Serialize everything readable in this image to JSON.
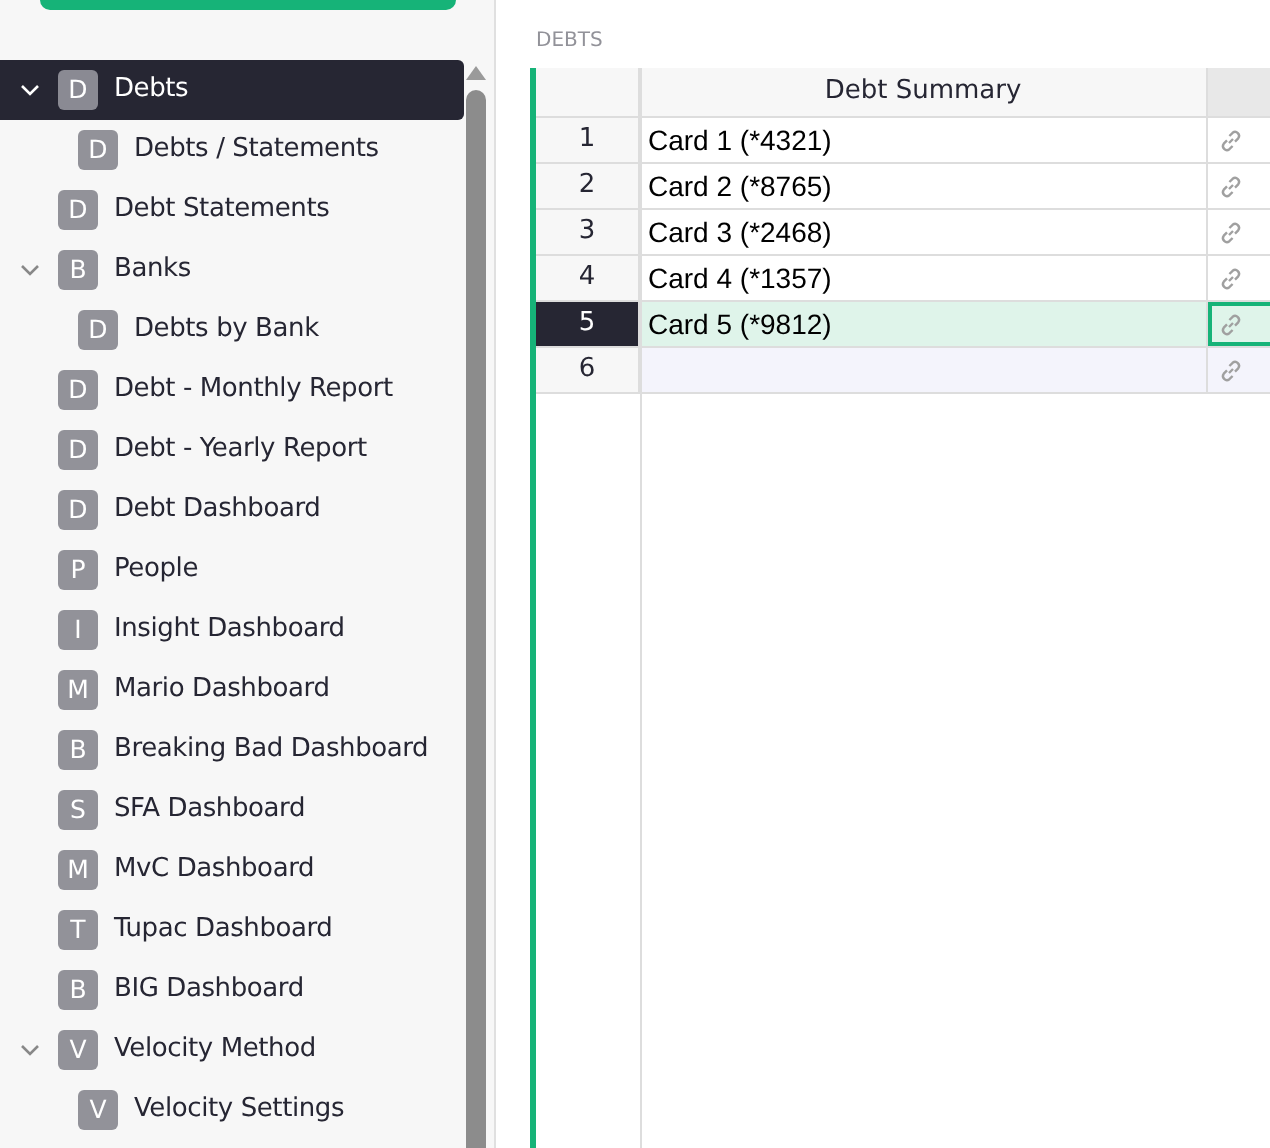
{
  "sidebar": {
    "items": [
      {
        "label": "Debts",
        "badge": "D",
        "selected": true,
        "expanded": true,
        "children": [
          {
            "label": "Debts / Statements",
            "badge": "D",
            "selected": false
          }
        ]
      },
      {
        "label": "Debt Statements",
        "badge": "D",
        "selected": false
      },
      {
        "label": "Banks",
        "badge": "B",
        "selected": false,
        "expanded": true,
        "children": [
          {
            "label": "Debts by Bank",
            "badge": "D",
            "selected": false
          }
        ]
      },
      {
        "label": "Debt - Monthly Report",
        "badge": "D",
        "selected": false
      },
      {
        "label": "Debt - Yearly Report",
        "badge": "D",
        "selected": false
      },
      {
        "label": "Debt Dashboard",
        "badge": "D",
        "selected": false
      },
      {
        "label": "People",
        "badge": "P",
        "selected": false
      },
      {
        "label": "Insight Dashboard",
        "badge": "I",
        "selected": false
      },
      {
        "label": "Mario Dashboard",
        "badge": "M",
        "selected": false
      },
      {
        "label": "Breaking Bad Dashboard",
        "badge": "B",
        "selected": false
      },
      {
        "label": "SFA Dashboard",
        "badge": "S",
        "selected": false
      },
      {
        "label": "MvC Dashboard",
        "badge": "M",
        "selected": false
      },
      {
        "label": "Tupac Dashboard",
        "badge": "T",
        "selected": false
      },
      {
        "label": "BIG Dashboard",
        "badge": "B",
        "selected": false
      },
      {
        "label": "Velocity Method",
        "badge": "V",
        "selected": false,
        "expanded": true,
        "children": [
          {
            "label": "Velocity Settings",
            "badge": "V",
            "selected": false
          }
        ]
      }
    ]
  },
  "table": {
    "title": "DEBTS",
    "columns": [
      "Debt Summary"
    ],
    "rows": [
      {
        "number": "1",
        "cell": "Card 1 (*4321)",
        "selected": false,
        "kind": "record"
      },
      {
        "number": "2",
        "cell": "Card 2 (*8765)",
        "selected": false,
        "kind": "record"
      },
      {
        "number": "3",
        "cell": "Card 3 (*2468)",
        "selected": false,
        "kind": "record"
      },
      {
        "number": "4",
        "cell": "Card 4 (*1357)",
        "selected": false,
        "kind": "record"
      },
      {
        "number": "5",
        "cell": "Card 5 (*9812)",
        "selected": true,
        "kind": "record"
      },
      {
        "number": "6",
        "cell": "",
        "selected": false,
        "kind": "new"
      }
    ]
  }
}
